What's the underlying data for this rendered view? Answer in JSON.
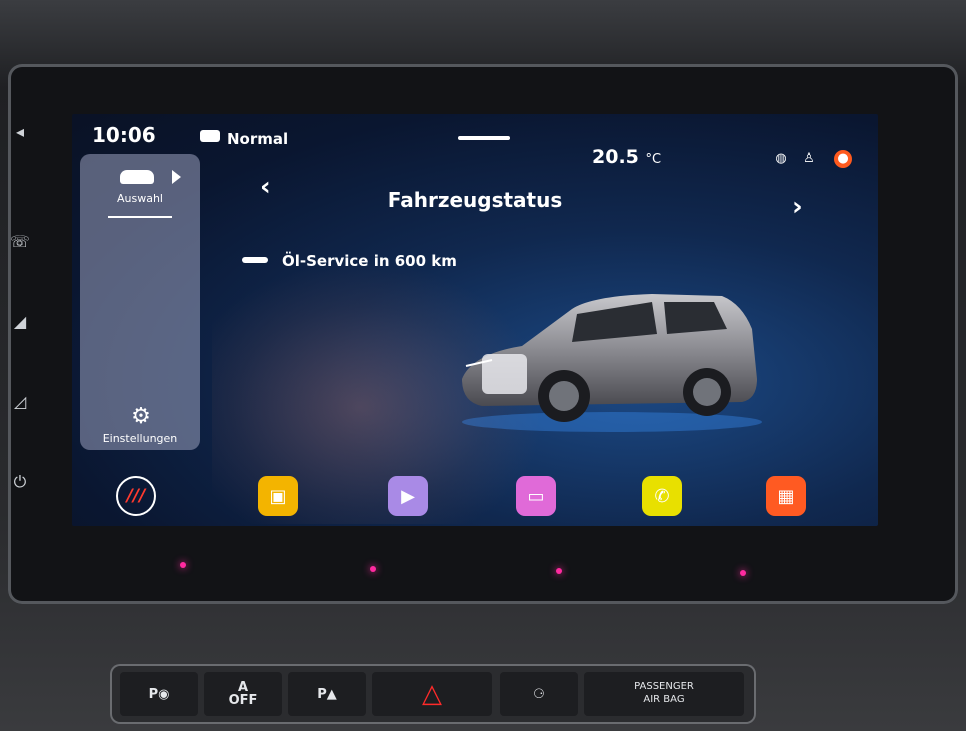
{
  "status": {
    "time": "10:06",
    "mode": "Normal",
    "temperature": "20.5",
    "temp_unit": "°C"
  },
  "sidebar": {
    "select_label": "Auswahl",
    "settings_label": "Einstellungen"
  },
  "page": {
    "title": "Fahrzeugstatus",
    "service_text": "Öl-Service in 600 km"
  },
  "dock": {
    "seat_label": "///"
  },
  "hardware": {
    "park_button": "P",
    "auto_off_top": "A",
    "auto_off_bottom": "OFF",
    "park_assist": "P",
    "airbag_line1": "PASSENGER",
    "airbag_line2": "AIR BAG"
  },
  "colors": {
    "accent": "#ff3a2e",
    "screen_bg": "#10284f"
  },
  "icons": [
    "car-icon",
    "play-icon",
    "settings-gear-icon",
    "wrench-icon",
    "globe-icon",
    "person-icon",
    "notification-icon",
    "seat-icon",
    "vehicle-app-icon",
    "media-app-icon",
    "radio-app-icon",
    "phone-app-icon",
    "apps-icon",
    "hazard-icon"
  ]
}
